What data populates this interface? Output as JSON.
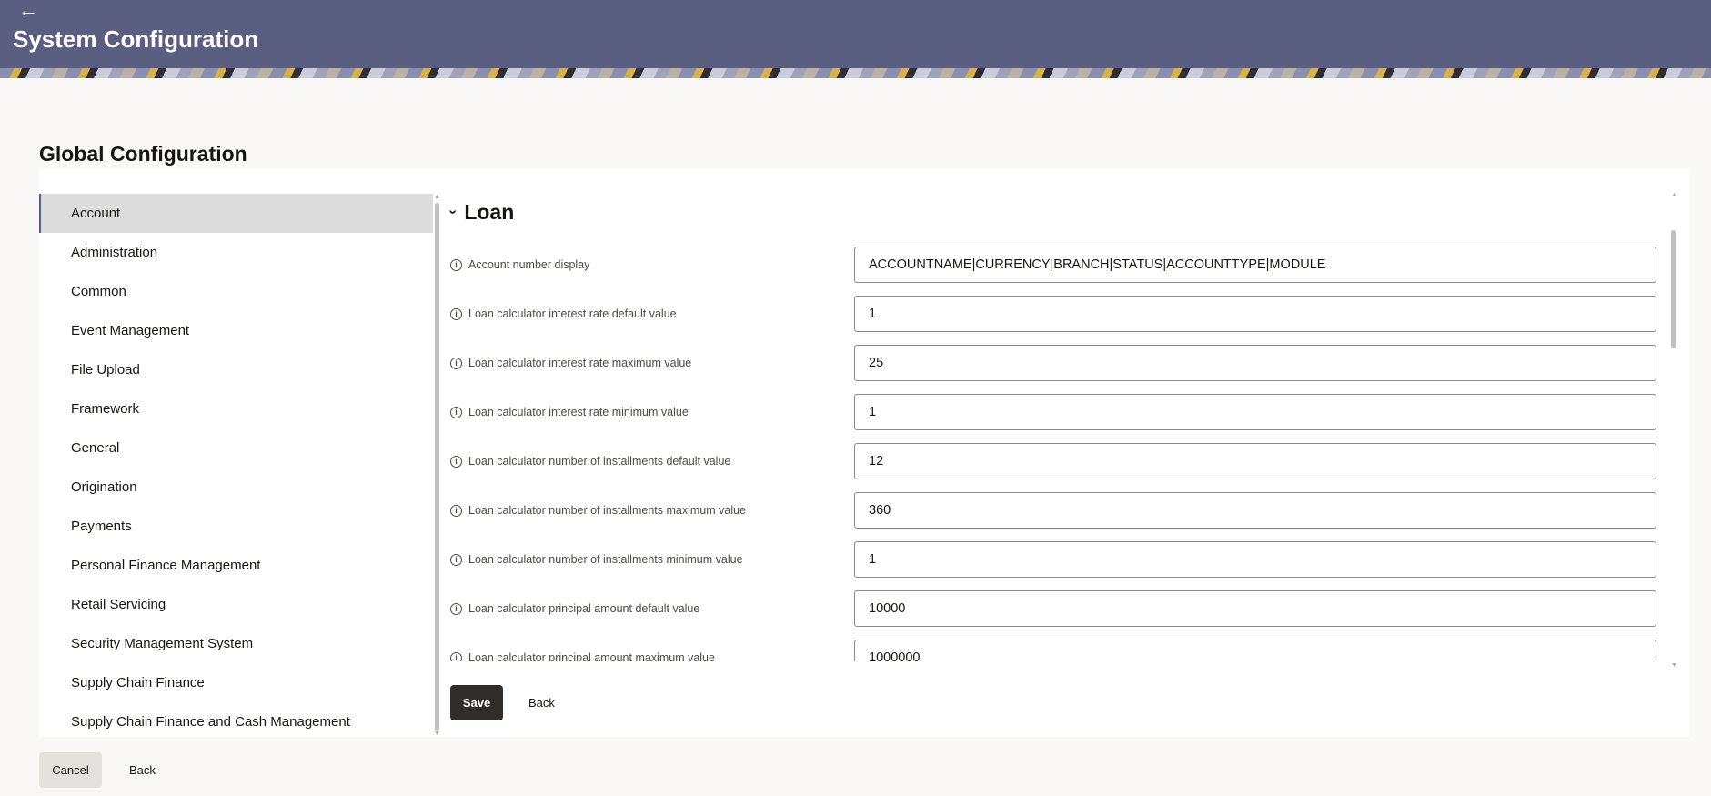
{
  "header": {
    "title": "System Configuration",
    "back_icon": "arrow-left-icon",
    "background_color": "#5a5e80"
  },
  "page": {
    "title": "Global Configuration"
  },
  "sidebar": {
    "items": [
      {
        "label": "Account",
        "active": true
      },
      {
        "label": "Administration"
      },
      {
        "label": "Common"
      },
      {
        "label": "Event Management"
      },
      {
        "label": "File Upload"
      },
      {
        "label": "Framework"
      },
      {
        "label": "General"
      },
      {
        "label": "Origination"
      },
      {
        "label": "Payments"
      },
      {
        "label": "Personal Finance Management"
      },
      {
        "label": "Retail Servicing"
      },
      {
        "label": "Security Management System"
      },
      {
        "label": "Supply Chain Finance"
      },
      {
        "label": "Supply Chain Finance and Cash Management"
      }
    ]
  },
  "section": {
    "title": "Loan",
    "expanded": true,
    "fields": [
      {
        "label": "Account number display",
        "value": "ACCOUNTNAME|CURRENCY|BRANCH|STATUS|ACCOUNTTYPE|MODULE"
      },
      {
        "label": "Loan calculator interest rate default value",
        "value": "1"
      },
      {
        "label": "Loan calculator interest rate maximum value",
        "value": "25"
      },
      {
        "label": "Loan calculator interest rate minimum value",
        "value": "1"
      },
      {
        "label": "Loan calculator number of installments default value",
        "value": "12"
      },
      {
        "label": "Loan calculator number of installments maximum value",
        "value": "360"
      },
      {
        "label": "Loan calculator number of installments minimum value",
        "value": "1"
      },
      {
        "label": "Loan calculator principal amount default value",
        "value": "10000"
      },
      {
        "label": "Loan calculator principal amount maximum value",
        "value": "1000000"
      }
    ]
  },
  "actions": {
    "save_label": "Save",
    "back_label": "Back",
    "cancel_label": "Cancel",
    "bottom_back_label": "Back"
  }
}
